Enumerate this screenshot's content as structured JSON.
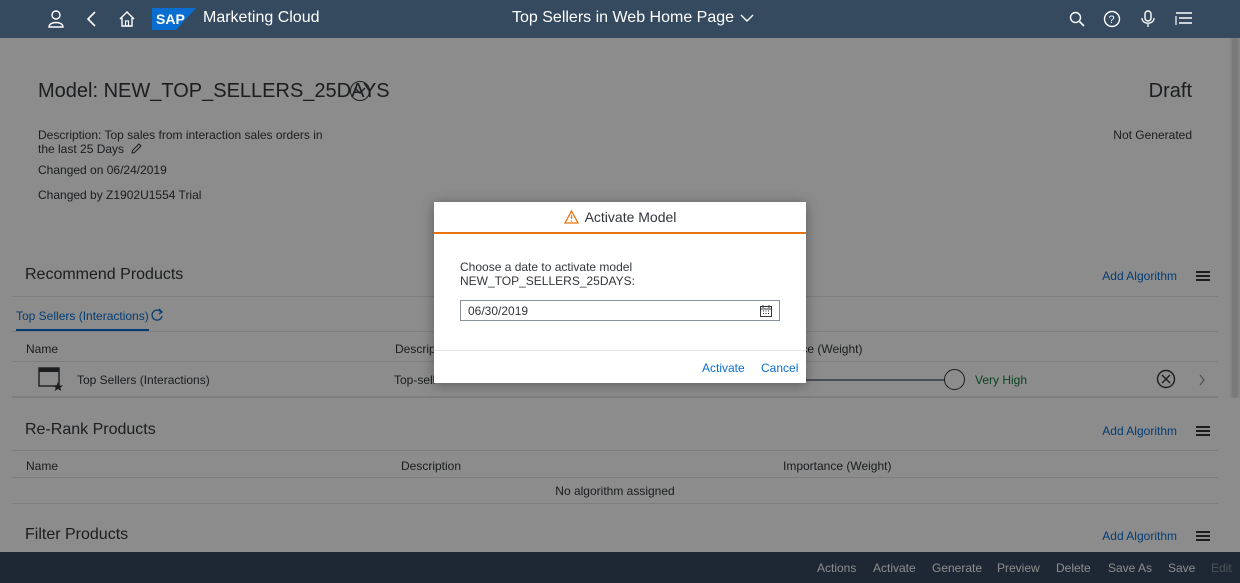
{
  "shell": {
    "app_name": "Marketing Cloud",
    "page_title": "Top Sellers in Web Home Page"
  },
  "object": {
    "title": "Model: NEW_TOP_SELLERS_25DAYS",
    "status": "Draft",
    "generation_status": "Not Generated",
    "description": "Description: Top sales from interaction sales orders in the last 25 Days",
    "changed_on": "Changed on 06/24/2019",
    "changed_by": "Changed by Z1902U1554 Trial"
  },
  "recommend": {
    "title": "Recommend Products",
    "add_label": "Add Algorithm",
    "tab_label": "Top Sellers (Interactions)",
    "columns": [
      "Name",
      "Descrip",
      "ance (Weight)"
    ],
    "row": {
      "name": "Top Sellers (Interactions)",
      "description": "Top-sell",
      "importance": "Very High",
      "slider_value": 1
    }
  },
  "rerank": {
    "title": "Re-Rank Products",
    "add_label": "Add Algorithm",
    "columns": [
      "Name",
      "Description",
      "Importance (Weight)"
    ],
    "empty_text": "No algorithm assigned"
  },
  "filter": {
    "title": "Filter Products",
    "add_label": "Add Algorithm"
  },
  "footer": {
    "buttons": [
      "Actions",
      "Activate",
      "Generate",
      "Preview",
      "Delete",
      "Save As",
      "Save",
      "Edit"
    ]
  },
  "dialog": {
    "title": "Activate Model",
    "text": "Choose a date to activate model NEW_TOP_SELLERS_25DAYS:",
    "date_value": "06/30/2019",
    "activate_label": "Activate",
    "cancel_label": "Cancel"
  },
  "colors": {
    "shell": "#354a5f",
    "link": "#0a6ed1",
    "warning": "#e9730c",
    "positive": "#107e3e"
  }
}
